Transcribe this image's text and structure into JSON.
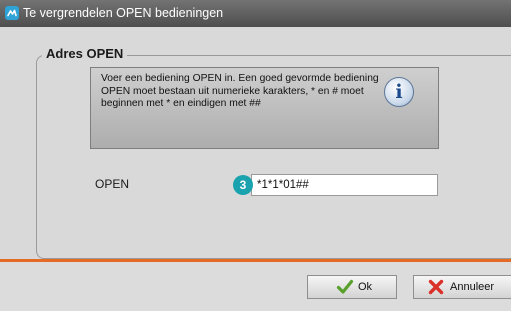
{
  "window": {
    "title": "Te vergrendelen OPEN bedieningen"
  },
  "group": {
    "legend": "Adres OPEN"
  },
  "info": {
    "text": "Voer een bediening OPEN in. Een goed gevormde bediening OPEN moet bestaan uit numerieke karakters, * en # moet beginnen met * en eindigen met ##",
    "icon": "info-icon"
  },
  "field": {
    "label": "OPEN",
    "value": "*1*1*01##",
    "step_badge": "3"
  },
  "buttons": {
    "ok_label": "Ok",
    "cancel_label": "Annuleer"
  },
  "colors": {
    "titlebar": "#5a5a5a",
    "accent_line": "#e56a26",
    "step_badge": "#1aa3ae",
    "ok_check": "#5aa02c",
    "cancel_x": "#d9302a"
  }
}
